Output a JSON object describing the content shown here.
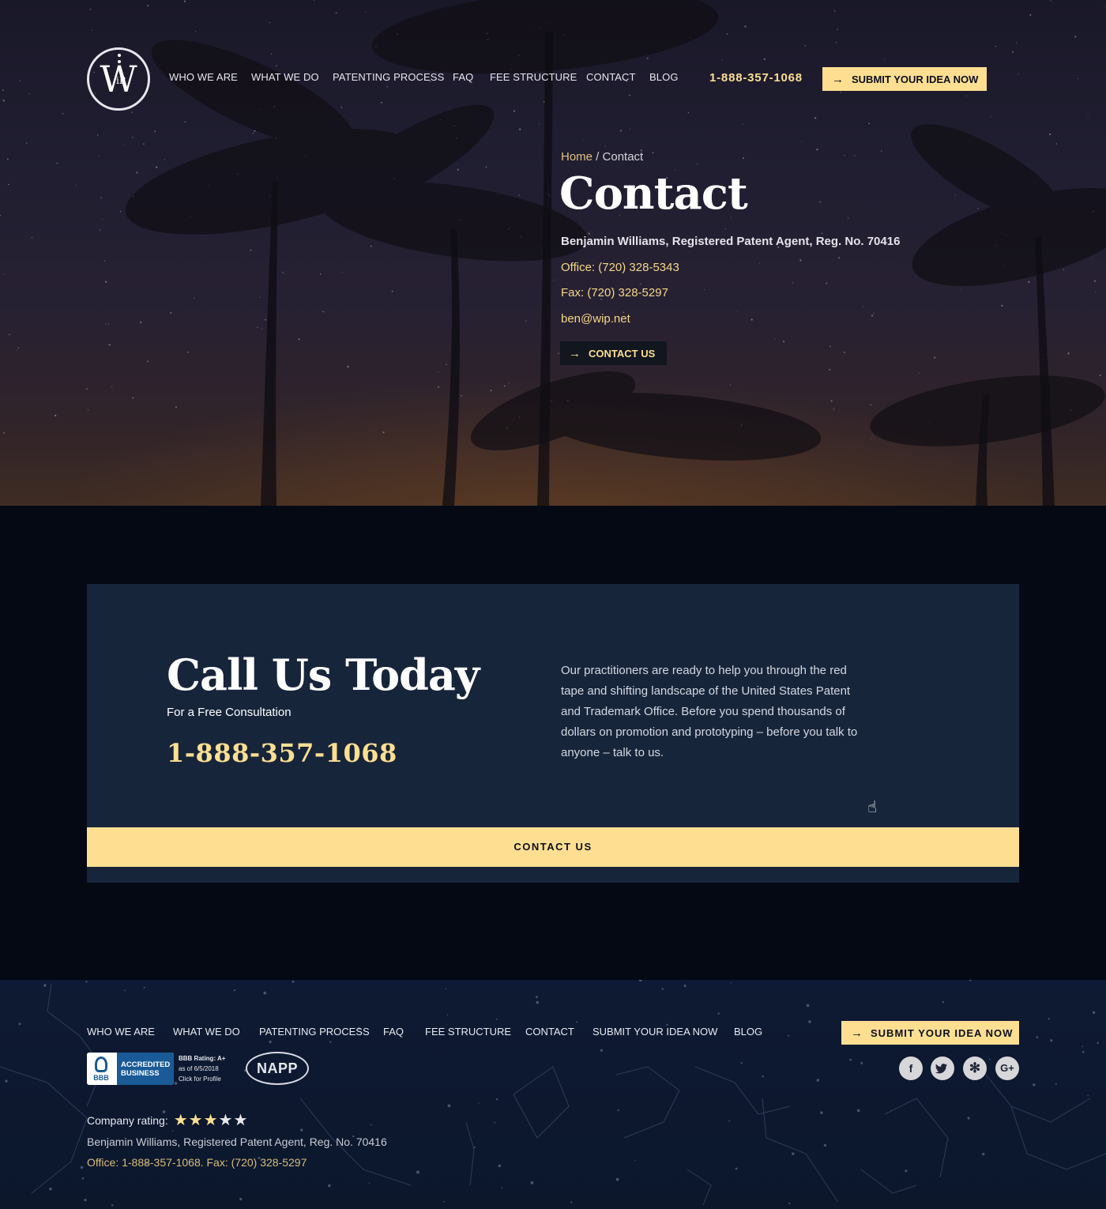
{
  "header": {
    "logo_letter": "W",
    "logo_sub": "iP",
    "nav": [
      "WHO WE ARE",
      "WHAT WE DO",
      "PATENTING PROCESS",
      "FAQ",
      "FEE STRUCTURE",
      "CONTACT",
      "BLOG"
    ],
    "phone": "1-888-357-1068",
    "submit_label": "SUBMIT YOUR IDEA NOW"
  },
  "hero": {
    "breadcrumb_home": "Home",
    "breadcrumb_sep": " / ",
    "breadcrumb_current": "Contact",
    "title": "Contact",
    "agent": "Benjamin Williams, Registered Patent Agent, Reg. No. 70416",
    "office": "Office: (720) 328-5343",
    "fax": "Fax: (720) 328-5297",
    "email": "ben@wip.net",
    "contact_label": "CONTACT US"
  },
  "call": {
    "title": "Call Us Today",
    "subtitle": "For a Free Consultation",
    "phone": "1-888-357-1068",
    "text": "Our practitioners are ready to help you through the red tape and shifting landscape of the United States Patent and Trademark Office. Before you spend thousands of dollars on promotion and prototyping – before you talk to anyone – talk to us.",
    "contact_label": "CONTACT US"
  },
  "footer": {
    "nav": [
      "WHO WE ARE",
      "WHAT WE DO",
      "PATENTING PROCESS",
      "FAQ",
      "FEE STRUCTURE",
      "CONTACT",
      "SUBMIT YOUR IDEA NOW",
      "BLOG"
    ],
    "submit_label": "SUBMIT YOUR IDEA NOW",
    "bbb_mark": "BBB",
    "bbb_accredited": "ACCREDITED",
    "bbb_business": "BUSINESS",
    "bbb_rating": "BBB Rating: A+",
    "bbb_date": "as of 6/5/2018",
    "bbb_click": "Click for Profile",
    "napp": "NAPP",
    "social": [
      {
        "icon": "facebook-icon",
        "glyph": "f"
      },
      {
        "icon": "twitter-icon",
        "glyph": "t"
      },
      {
        "icon": "yelp-icon",
        "glyph": "✻"
      },
      {
        "icon": "google-plus-icon",
        "glyph": "G+"
      }
    ],
    "rating_label": "Company rating:",
    "rating_value": 3,
    "rating_max": 5,
    "agent": "Benjamin Williams, Registered Patent Agent, Reg. No. 70416",
    "office": "Office: 1-888-357-1068. Fax: (720) 328-5297"
  },
  "colors": {
    "accent": "#fedf92",
    "card": "#17253b",
    "page": "#050914",
    "footer": "#0e1a33"
  }
}
